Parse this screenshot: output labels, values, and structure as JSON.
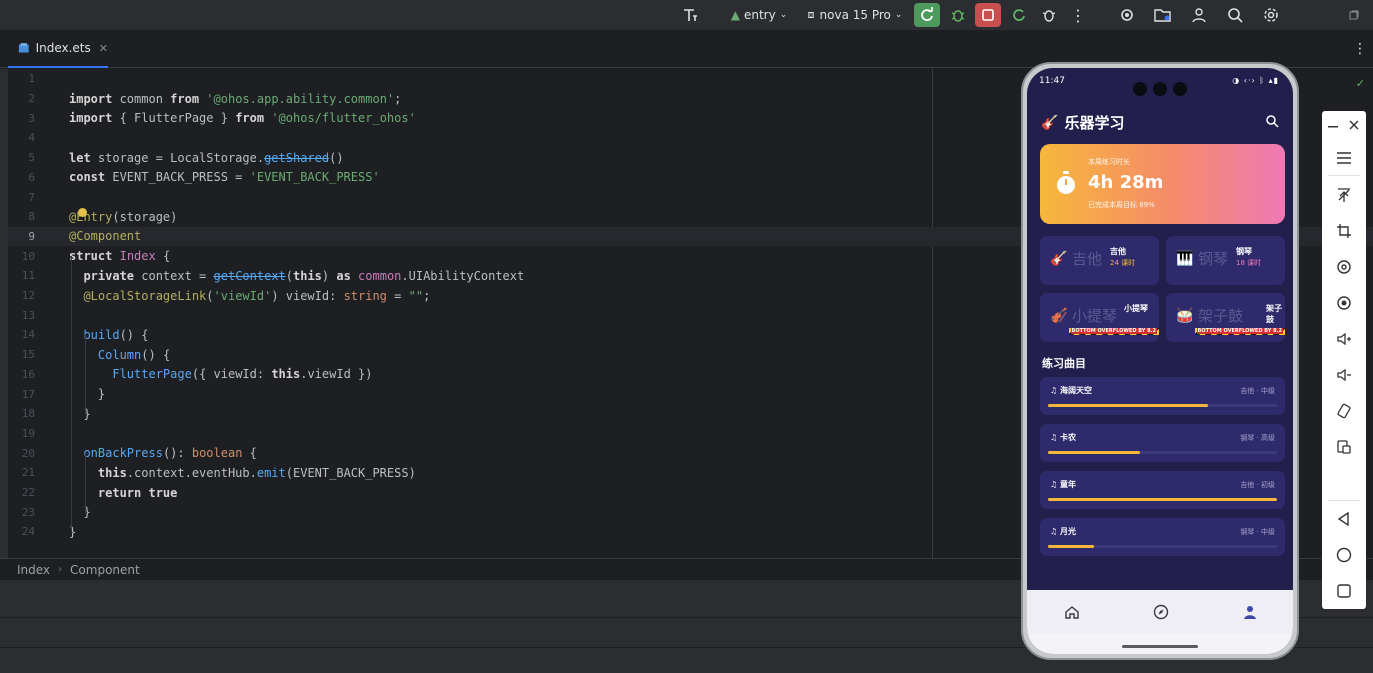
{
  "toolbar": {
    "module": "entry",
    "device": "nova 15 Pro"
  },
  "editor": {
    "tab_name": "Index.ets",
    "line_numbers": [
      "1",
      "2",
      "3",
      "4",
      "5",
      "6",
      "7",
      "8",
      "9",
      "10",
      "11",
      "12",
      "13",
      "14",
      "15",
      "16",
      "17",
      "18",
      "19",
      "20",
      "21",
      "22",
      "23",
      "24"
    ],
    "current_line": 9
  },
  "breadcrumb": [
    "Index",
    "Component"
  ],
  "phone": {
    "status_time": "11:47",
    "status_right": "◑ ‹·› ᛒ ▴▮",
    "app_title": "乐器学习",
    "hero": {
      "label": "本周练习时长",
      "value": "4h 28m",
      "sub": "已完成本周目标 89%"
    },
    "instruments": [
      {
        "big": "吉他",
        "name": "吉他",
        "count": "24 课时",
        "emoji": "🎸"
      },
      {
        "big": "钢琴",
        "name": "钢琴",
        "count": "18 课时",
        "emoji": "🎹"
      },
      {
        "big": "小提琴",
        "name": "小提琴",
        "count": "",
        "emoji": "🎻"
      },
      {
        "big": "架子鼓",
        "name": "架子鼓",
        "count": "",
        "emoji": "🥁"
      }
    ],
    "overflow_text": "BOTTOM OVERFLOWED BY 8.2",
    "section_title": "练习曲目",
    "songs": [
      {
        "title": "海阔天空",
        "meta": "吉他 · 中级",
        "progress": 0.7
      },
      {
        "title": "卡农",
        "meta": "钢琴 · 高级",
        "progress": 0.4
      },
      {
        "title": "童年",
        "meta": "吉他 · 初级",
        "progress": 1.0
      },
      {
        "title": "月光",
        "meta": "钢琴 · 中级",
        "progress": 0.2
      }
    ]
  },
  "colors": {
    "accent_orange": "#f6b83a",
    "accent_pink": "#ef79b5",
    "phone_bg": "#231f4d",
    "card_bg": "#2e2a6b"
  }
}
